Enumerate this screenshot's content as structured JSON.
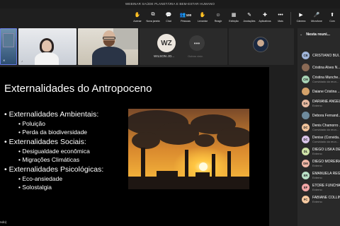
{
  "window": {
    "title": "WEBINAR SAÚDE PLANETÁRIA E BEM-ESTAR HUMANO"
  },
  "toolbar": [
    {
      "icon": "hand-wave-icon",
      "glyph": "✋",
      "label": "Acenar"
    },
    {
      "icon": "new-window-icon",
      "glyph": "⧉",
      "label": "Nova janela"
    },
    {
      "icon": "chat-icon",
      "glyph": "💬",
      "label": "Chat"
    },
    {
      "icon": "people-icon",
      "glyph": "👥",
      "label": "Pessoas",
      "badge": "100"
    },
    {
      "icon": "raise-hand-icon",
      "glyph": "✋",
      "label": "Levantar"
    },
    {
      "icon": "react-icon",
      "glyph": "☺",
      "label": "Reagir"
    },
    {
      "icon": "view-icon",
      "glyph": "▦",
      "label": "Exibição"
    },
    {
      "icon": "notes-icon",
      "glyph": "✎",
      "label": "Anotações"
    },
    {
      "icon": "apps-icon",
      "glyph": "✚",
      "label": "Aplicativos"
    },
    {
      "icon": "more-icon",
      "glyph": "•••",
      "label": "Mais"
    },
    {
      "icon": "camera-icon",
      "glyph": "▶",
      "label": "Câmera"
    },
    {
      "icon": "mic-icon",
      "glyph": "🎤",
      "label": "Microfone"
    },
    {
      "icon": "share-icon",
      "glyph": "⬆",
      "label": "Com"
    }
  ],
  "tiles": {
    "wz_initials": "WZ",
    "wz_name": "WILSON JO...",
    "more_label": "Outros visiv."
  },
  "slide": {
    "title": "Externalidades do Antropoceno",
    "sections": [
      {
        "heading": "Externalidades Ambientais:",
        "items": [
          "Poluição",
          "Perda da biodiversidade"
        ]
      },
      {
        "heading": "Externalidades Sociais:",
        "items": [
          "Desigualdade econômica",
          "Migrações Climáticas"
        ]
      },
      {
        "heading": "Externalidades Psicológicas:",
        "items": [
          "Eco-ansiedade",
          "Solostalgia"
        ]
      }
    ],
    "footer": "ndo)"
  },
  "panel": {
    "title": "Nesta reuni...",
    "participants": [
      {
        "initials": "CB",
        "name": "CRISTIANO BUI...",
        "sub": "",
        "color": "#9fb4d8"
      },
      {
        "initials": "",
        "name": "Cristina Alves N...",
        "sub": "",
        "color": "#8a6a55"
      },
      {
        "initials": "CM",
        "name": "Cristina Munche...",
        "sub": "Convidado da reun...",
        "color": "#a7d3b5"
      },
      {
        "initials": "",
        "name": "Daiane Cristina ...",
        "sub": "",
        "color": "#d4a26a"
      },
      {
        "initials": "DA",
        "name": "DARIANE ANGEL...",
        "sub": "Externo",
        "color": "#e7b9a0"
      },
      {
        "initials": "",
        "name": "Debora Fernand...",
        "sub": "",
        "color": "#6e8a9c"
      },
      {
        "initials": "DC",
        "name": "Denis Chamorro ...",
        "sub": "Convidado da reun...",
        "color": "#f1c39a"
      },
      {
        "initials": "DC",
        "name": "Denise (Convida...",
        "sub": "Convidado da reun...",
        "color": "#d9c4e8"
      },
      {
        "initials": "DL",
        "name": "DIEGO LISKA DE...",
        "sub": "Externo",
        "color": "#cfe3a8"
      },
      {
        "initials": "DM",
        "name": "DIEGO MOREIRA ...",
        "sub": "Externo",
        "color": "#f0b7a7"
      },
      {
        "initials": "ER",
        "name": "EMANUELA REG...",
        "sub": "Externo",
        "color": "#b9e0c6"
      },
      {
        "initials": "EF",
        "name": "ETORE FUNCHA...",
        "sub": "Externo",
        "color": "#f2a6a6"
      },
      {
        "initials": "FC",
        "name": "FABIANE COLLIN...",
        "sub": "Externo",
        "color": "#f5c9a0"
      }
    ]
  }
}
